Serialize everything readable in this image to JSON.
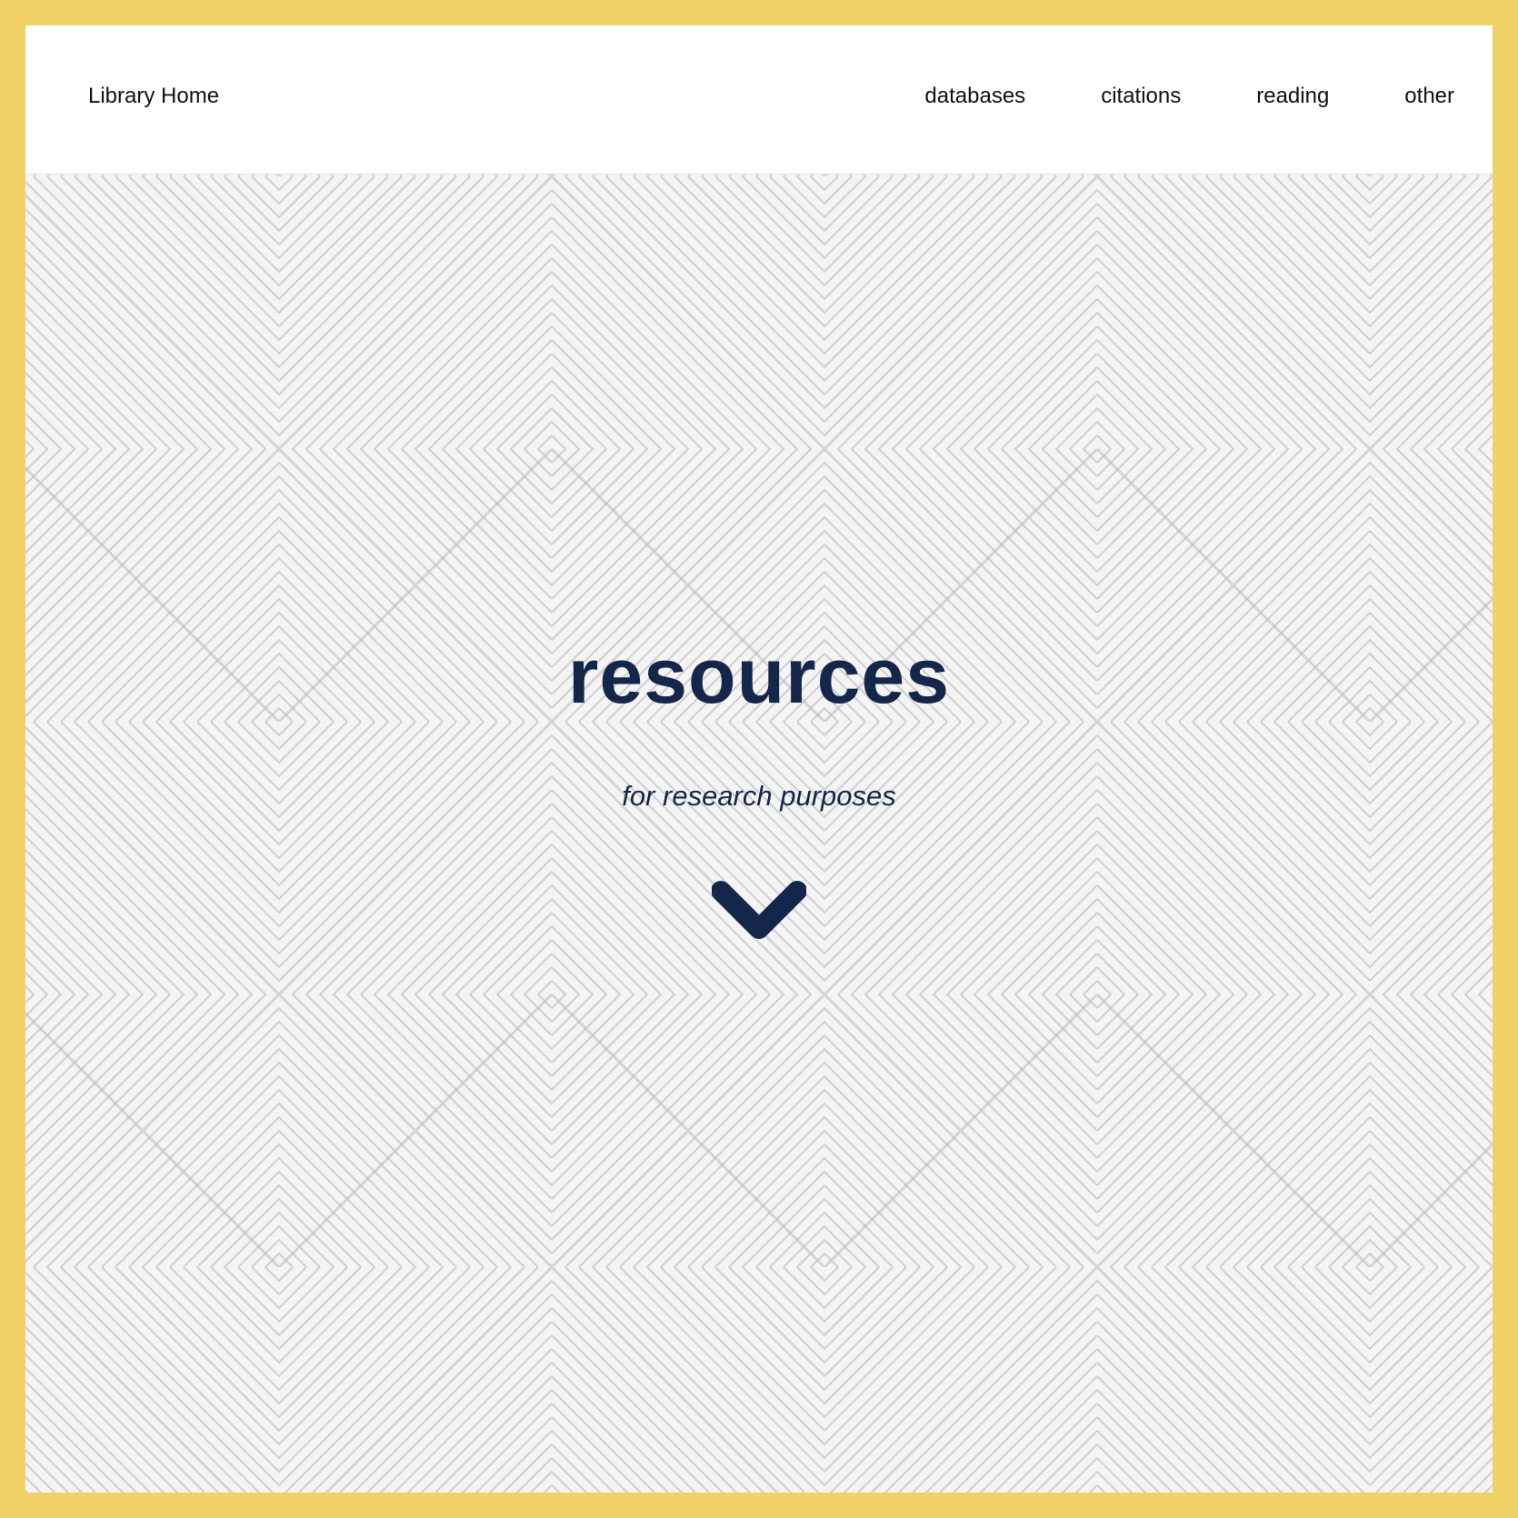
{
  "header": {
    "brand": "Library Home",
    "nav": [
      "databases",
      "citations",
      "reading",
      "other"
    ]
  },
  "hero": {
    "title": "resources",
    "subtitle": "for research purposes",
    "scroll_icon": "chevron-down-icon"
  },
  "colors": {
    "frame": "#f1d266",
    "accent": "#14264a",
    "navbar_bg": "#ffffff",
    "hero_bg": "#f4f4f4",
    "pattern_line": "#cfcfcf"
  }
}
